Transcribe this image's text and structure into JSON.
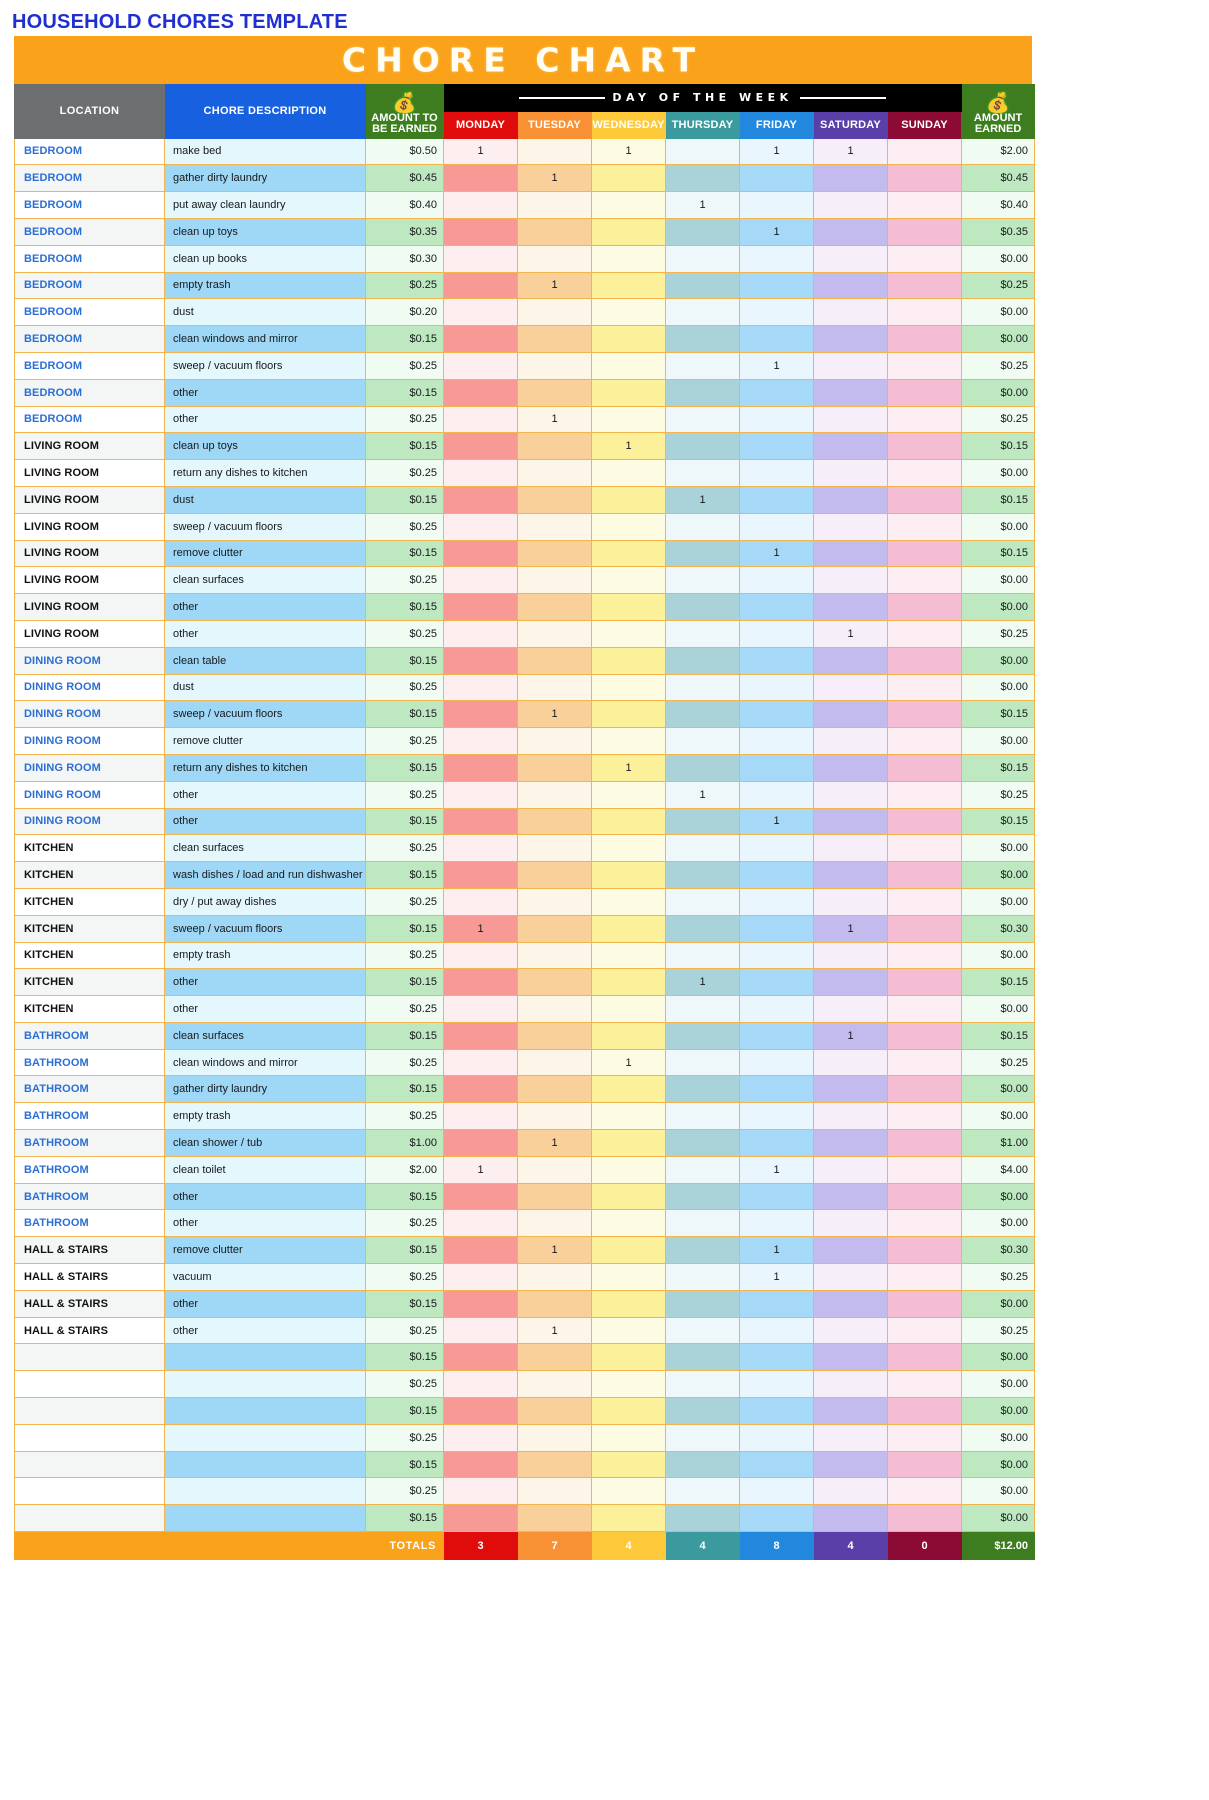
{
  "document": {
    "title": "HOUSEHOLD CHORES TEMPLATE",
    "banner": "CHORE CHART",
    "title_color": "#1f2fd0",
    "banner_bg": "#f9a21a"
  },
  "table": {
    "headers": {
      "location": "LOCATION",
      "description": "CHORE DESCRIPTION",
      "amount_to_be_earned_l1": "AMOUNT TO",
      "amount_to_be_earned_l2": "BE EARNED",
      "day_of_week_group": "DAY OF THE WEEK",
      "amount_earned_l1": "AMOUNT",
      "amount_earned_l2": "EARNED",
      "money_icon": "money-bag-icon"
    },
    "days": [
      {
        "label": "MONDAY",
        "header_bg": "#e00c0c",
        "light": "#fdeef0",
        "dark": "#f79a95"
      },
      {
        "label": "TUESDAY",
        "header_bg": "#f79133",
        "light": "#fdf6e8",
        "dark": "#f9cf9a"
      },
      {
        "label": "WEDNESDAY",
        "header_bg": "#fdc93a",
        "light": "#fefbe3",
        "dark": "#fcf09a"
      },
      {
        "label": "THURSDAY",
        "header_bg": "#3b9a9e",
        "light": "#eef8fa",
        "dark": "#a9d3d8"
      },
      {
        "label": "FRIDAY",
        "header_bg": "#2188dd",
        "light": "#eaf6fd",
        "dark": "#a6d8f7"
      },
      {
        "label": "SATURDAY",
        "header_bg": "#5a3fa8",
        "light": "#f6effa",
        "dark": "#c3bbee"
      },
      {
        "label": "SUNDAY",
        "header_bg": "#8b0b35",
        "light": "#fdeef4",
        "dark": "#f4bdd4"
      }
    ],
    "colors": {
      "desc_light": "#e4f7fd",
      "desc_dark": "#9fd8f7",
      "amt_light": "#f0fbf2",
      "amt_dark": "#bde8c0",
      "loc_light": "#ffffff",
      "loc_dark": "#f4f6f5",
      "grid": "#f2b44d"
    },
    "totals": {
      "label": "TOTALS",
      "values": [
        "3",
        "7",
        "4",
        "4",
        "8",
        "4",
        "0"
      ],
      "grand_total": "$12.00"
    },
    "rows": [
      {
        "location": "BEDROOM",
        "location_color": "blue",
        "description": "make bed",
        "amount": "$0.50",
        "marks": [
          "1",
          "",
          "1",
          "",
          "1",
          "1",
          ""
        ],
        "earned": "$2.00"
      },
      {
        "location": "BEDROOM",
        "location_color": "blue",
        "description": "gather dirty laundry",
        "amount": "$0.45",
        "marks": [
          "",
          "1",
          "",
          "",
          "",
          "",
          ""
        ],
        "earned": "$0.45"
      },
      {
        "location": "BEDROOM",
        "location_color": "blue",
        "description": "put away clean laundry",
        "amount": "$0.40",
        "marks": [
          "",
          "",
          "",
          "1",
          "",
          "",
          ""
        ],
        "earned": "$0.40"
      },
      {
        "location": "BEDROOM",
        "location_color": "blue",
        "description": "clean up toys",
        "amount": "$0.35",
        "marks": [
          "",
          "",
          "",
          "",
          "1",
          "",
          ""
        ],
        "earned": "$0.35"
      },
      {
        "location": "BEDROOM",
        "location_color": "blue",
        "description": "clean up books",
        "amount": "$0.30",
        "marks": [
          "",
          "",
          "",
          "",
          "",
          "",
          ""
        ],
        "earned": "$0.00"
      },
      {
        "location": "BEDROOM",
        "location_color": "blue",
        "description": "empty trash",
        "amount": "$0.25",
        "marks": [
          "",
          "1",
          "",
          "",
          "",
          "",
          ""
        ],
        "earned": "$0.25"
      },
      {
        "location": "BEDROOM",
        "location_color": "blue",
        "description": "dust",
        "amount": "$0.20",
        "marks": [
          "",
          "",
          "",
          "",
          "",
          "",
          ""
        ],
        "earned": "$0.00"
      },
      {
        "location": "BEDROOM",
        "location_color": "blue",
        "description": "clean windows and mirror",
        "amount": "$0.15",
        "marks": [
          "",
          "",
          "",
          "",
          "",
          "",
          ""
        ],
        "earned": "$0.00"
      },
      {
        "location": "BEDROOM",
        "location_color": "blue",
        "description": "sweep / vacuum floors",
        "amount": "$0.25",
        "marks": [
          "",
          "",
          "",
          "",
          "1",
          "",
          ""
        ],
        "earned": "$0.25"
      },
      {
        "location": "BEDROOM",
        "location_color": "blue",
        "description": "other",
        "amount": "$0.15",
        "marks": [
          "",
          "",
          "",
          "",
          "",
          "",
          ""
        ],
        "earned": "$0.00"
      },
      {
        "location": "BEDROOM",
        "location_color": "blue",
        "description": "other",
        "amount": "$0.25",
        "marks": [
          "",
          "1",
          "",
          "",
          "",
          "",
          ""
        ],
        "earned": "$0.25"
      },
      {
        "location": "LIVING ROOM",
        "location_color": "dark",
        "description": "clean up toys",
        "amount": "$0.15",
        "marks": [
          "",
          "",
          "1",
          "",
          "",
          "",
          ""
        ],
        "earned": "$0.15"
      },
      {
        "location": "LIVING ROOM",
        "location_color": "dark",
        "description": "return any dishes to kitchen",
        "amount": "$0.25",
        "marks": [
          "",
          "",
          "",
          "",
          "",
          "",
          ""
        ],
        "earned": "$0.00"
      },
      {
        "location": "LIVING ROOM",
        "location_color": "dark",
        "description": "dust",
        "amount": "$0.15",
        "marks": [
          "",
          "",
          "",
          "1",
          "",
          "",
          ""
        ],
        "earned": "$0.15"
      },
      {
        "location": "LIVING ROOM",
        "location_color": "dark",
        "description": "sweep / vacuum floors",
        "amount": "$0.25",
        "marks": [
          "",
          "",
          "",
          "",
          "",
          "",
          ""
        ],
        "earned": "$0.00"
      },
      {
        "location": "LIVING ROOM",
        "location_color": "dark",
        "description": "remove clutter",
        "amount": "$0.15",
        "marks": [
          "",
          "",
          "",
          "",
          "1",
          "",
          ""
        ],
        "earned": "$0.15"
      },
      {
        "location": "LIVING ROOM",
        "location_color": "dark",
        "description": "clean surfaces",
        "amount": "$0.25",
        "marks": [
          "",
          "",
          "",
          "",
          "",
          "",
          ""
        ],
        "earned": "$0.00"
      },
      {
        "location": "LIVING ROOM",
        "location_color": "dark",
        "description": "other",
        "amount": "$0.15",
        "marks": [
          "",
          "",
          "",
          "",
          "",
          "",
          ""
        ],
        "earned": "$0.00"
      },
      {
        "location": "LIVING ROOM",
        "location_color": "dark",
        "description": "other",
        "amount": "$0.25",
        "marks": [
          "",
          "",
          "",
          "",
          "",
          "1",
          ""
        ],
        "earned": "$0.25"
      },
      {
        "location": "DINING ROOM",
        "location_color": "blue",
        "description": "clean table",
        "amount": "$0.15",
        "marks": [
          "",
          "",
          "",
          "",
          "",
          "",
          ""
        ],
        "earned": "$0.00"
      },
      {
        "location": "DINING ROOM",
        "location_color": "blue",
        "description": "dust",
        "amount": "$0.25",
        "marks": [
          "",
          "",
          "",
          "",
          "",
          "",
          ""
        ],
        "earned": "$0.00"
      },
      {
        "location": "DINING ROOM",
        "location_color": "blue",
        "description": "sweep / vacuum floors",
        "amount": "$0.15",
        "marks": [
          "",
          "1",
          "",
          "",
          "",
          "",
          ""
        ],
        "earned": "$0.15"
      },
      {
        "location": "DINING ROOM",
        "location_color": "blue",
        "description": "remove clutter",
        "amount": "$0.25",
        "marks": [
          "",
          "",
          "",
          "",
          "",
          "",
          ""
        ],
        "earned": "$0.00"
      },
      {
        "location": "DINING ROOM",
        "location_color": "blue",
        "description": "return any dishes to kitchen",
        "amount": "$0.15",
        "marks": [
          "",
          "",
          "1",
          "",
          "",
          "",
          ""
        ],
        "earned": "$0.15"
      },
      {
        "location": "DINING ROOM",
        "location_color": "blue",
        "description": "other",
        "amount": "$0.25",
        "marks": [
          "",
          "",
          "",
          "1",
          "",
          "",
          ""
        ],
        "earned": "$0.25"
      },
      {
        "location": "DINING ROOM",
        "location_color": "blue",
        "description": "other",
        "amount": "$0.15",
        "marks": [
          "",
          "",
          "",
          "",
          "1",
          "",
          ""
        ],
        "earned": "$0.15"
      },
      {
        "location": "KITCHEN",
        "location_color": "dark",
        "description": "clean surfaces",
        "amount": "$0.25",
        "marks": [
          "",
          "",
          "",
          "",
          "",
          "",
          ""
        ],
        "earned": "$0.00"
      },
      {
        "location": "KITCHEN",
        "location_color": "dark",
        "description": "wash dishes / load and run dishwasher",
        "amount": "$0.15",
        "marks": [
          "",
          "",
          "",
          "",
          "",
          "",
          ""
        ],
        "earned": "$0.00"
      },
      {
        "location": "KITCHEN",
        "location_color": "dark",
        "description": "dry / put away dishes",
        "amount": "$0.25",
        "marks": [
          "",
          "",
          "",
          "",
          "",
          "",
          ""
        ],
        "earned": "$0.00"
      },
      {
        "location": "KITCHEN",
        "location_color": "dark",
        "description": "sweep / vacuum floors",
        "amount": "$0.15",
        "marks": [
          "1",
          "",
          "",
          "",
          "",
          "1",
          ""
        ],
        "earned": "$0.30"
      },
      {
        "location": "KITCHEN",
        "location_color": "dark",
        "description": "empty trash",
        "amount": "$0.25",
        "marks": [
          "",
          "",
          "",
          "",
          "",
          "",
          ""
        ],
        "earned": "$0.00"
      },
      {
        "location": "KITCHEN",
        "location_color": "dark",
        "description": "other",
        "amount": "$0.15",
        "marks": [
          "",
          "",
          "",
          "1",
          "",
          "",
          ""
        ],
        "earned": "$0.15"
      },
      {
        "location": "KITCHEN",
        "location_color": "dark",
        "description": "other",
        "amount": "$0.25",
        "marks": [
          "",
          "",
          "",
          "",
          "",
          "",
          ""
        ],
        "earned": "$0.00"
      },
      {
        "location": "BATHROOM",
        "location_color": "blue",
        "description": "clean surfaces",
        "amount": "$0.15",
        "marks": [
          "",
          "",
          "",
          "",
          "",
          "1",
          ""
        ],
        "earned": "$0.15"
      },
      {
        "location": "BATHROOM",
        "location_color": "blue",
        "description": "clean windows and mirror",
        "amount": "$0.25",
        "marks": [
          "",
          "",
          "1",
          "",
          "",
          "",
          ""
        ],
        "earned": "$0.25"
      },
      {
        "location": "BATHROOM",
        "location_color": "blue",
        "description": "gather dirty laundry",
        "amount": "$0.15",
        "marks": [
          "",
          "",
          "",
          "",
          "",
          "",
          ""
        ],
        "earned": "$0.00"
      },
      {
        "location": "BATHROOM",
        "location_color": "blue",
        "description": "empty trash",
        "amount": "$0.25",
        "marks": [
          "",
          "",
          "",
          "",
          "",
          "",
          ""
        ],
        "earned": "$0.00"
      },
      {
        "location": "BATHROOM",
        "location_color": "blue",
        "description": "clean shower / tub",
        "amount": "$1.00",
        "marks": [
          "",
          "1",
          "",
          "",
          "",
          "",
          ""
        ],
        "earned": "$1.00"
      },
      {
        "location": "BATHROOM",
        "location_color": "blue",
        "description": "clean toilet",
        "amount": "$2.00",
        "marks": [
          "1",
          "",
          "",
          "",
          "1",
          "",
          ""
        ],
        "earned": "$4.00"
      },
      {
        "location": "BATHROOM",
        "location_color": "blue",
        "description": "other",
        "amount": "$0.15",
        "marks": [
          "",
          "",
          "",
          "",
          "",
          "",
          ""
        ],
        "earned": "$0.00"
      },
      {
        "location": "BATHROOM",
        "location_color": "blue",
        "description": "other",
        "amount": "$0.25",
        "marks": [
          "",
          "",
          "",
          "",
          "",
          "",
          ""
        ],
        "earned": "$0.00"
      },
      {
        "location": "HALL & STAIRS",
        "location_color": "dark",
        "description": "remove clutter",
        "amount": "$0.15",
        "marks": [
          "",
          "1",
          "",
          "",
          "1",
          "",
          ""
        ],
        "earned": "$0.30"
      },
      {
        "location": "HALL & STAIRS",
        "location_color": "dark",
        "description": "vacuum",
        "amount": "$0.25",
        "marks": [
          "",
          "",
          "",
          "",
          "1",
          "",
          ""
        ],
        "earned": "$0.25"
      },
      {
        "location": "HALL & STAIRS",
        "location_color": "dark",
        "description": "other",
        "amount": "$0.15",
        "marks": [
          "",
          "",
          "",
          "",
          "",
          "",
          ""
        ],
        "earned": "$0.00"
      },
      {
        "location": "HALL & STAIRS",
        "location_color": "dark",
        "description": "other",
        "amount": "$0.25",
        "marks": [
          "",
          "1",
          "",
          "",
          "",
          "",
          ""
        ],
        "earned": "$0.25"
      },
      {
        "location": "",
        "location_color": "dark",
        "description": "",
        "amount": "$0.15",
        "marks": [
          "",
          "",
          "",
          "",
          "",
          "",
          ""
        ],
        "earned": "$0.00"
      },
      {
        "location": "",
        "location_color": "dark",
        "description": "",
        "amount": "$0.25",
        "marks": [
          "",
          "",
          "",
          "",
          "",
          "",
          ""
        ],
        "earned": "$0.00"
      },
      {
        "location": "",
        "location_color": "dark",
        "description": "",
        "amount": "$0.15",
        "marks": [
          "",
          "",
          "",
          "",
          "",
          "",
          ""
        ],
        "earned": "$0.00"
      },
      {
        "location": "",
        "location_color": "dark",
        "description": "",
        "amount": "$0.25",
        "marks": [
          "",
          "",
          "",
          "",
          "",
          "",
          ""
        ],
        "earned": "$0.00"
      },
      {
        "location": "",
        "location_color": "dark",
        "description": "",
        "amount": "$0.15",
        "marks": [
          "",
          "",
          "",
          "",
          "",
          "",
          ""
        ],
        "earned": "$0.00"
      },
      {
        "location": "",
        "location_color": "dark",
        "description": "",
        "amount": "$0.25",
        "marks": [
          "",
          "",
          "",
          "",
          "",
          "",
          ""
        ],
        "earned": "$0.00"
      },
      {
        "location": "",
        "location_color": "dark",
        "description": "",
        "amount": "$0.15",
        "marks": [
          "",
          "",
          "",
          "",
          "",
          "",
          ""
        ],
        "earned": "$0.00"
      }
    ]
  }
}
